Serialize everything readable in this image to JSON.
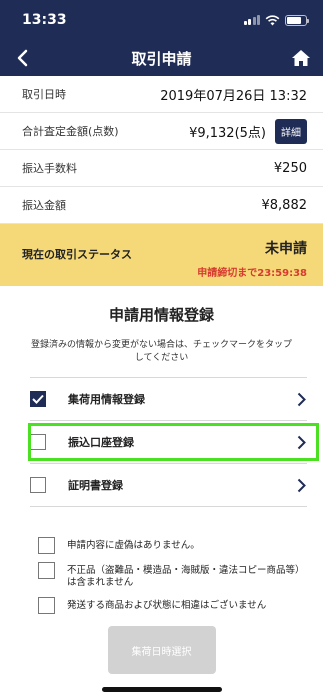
{
  "status_bar": {
    "time": "13:33"
  },
  "nav": {
    "title": "取引申請"
  },
  "info_rows": [
    {
      "label": "取引日時",
      "value": "2019年07月26日 13:32"
    },
    {
      "label": "合計査定金額(点数)",
      "value": "¥9,132(5点)",
      "button": "詳細"
    },
    {
      "label": "振込手数料",
      "value": "¥250"
    },
    {
      "label": "振込金額",
      "value": "¥8,882"
    }
  ],
  "status_panel": {
    "label": "現在の取引ステータス",
    "value": "未申請",
    "deadline": "申請締切まで23:59:38"
  },
  "registration": {
    "title": "申請用情報登録",
    "note": "登録済みの情報から変更がない場合は、チェックマークをタップしてください",
    "items": [
      {
        "label": "集荷用情報登録",
        "checked": true
      },
      {
        "label": "振込口座登録",
        "checked": false
      },
      {
        "label": "証明書登録",
        "checked": false
      }
    ]
  },
  "consents": [
    {
      "label": "申請内容に虚偽はありません。"
    },
    {
      "label": "不正品（盗難品・模造品・海賊版・違法コピー商品等）は含まれません"
    },
    {
      "label": "発送する商品および状態に相違はございません"
    }
  ],
  "submit": {
    "label": "集荷日時選択"
  },
  "colors": {
    "navy": "#1f2c55",
    "status_yellow": "#f5d878",
    "deadline_red": "#d63b2f",
    "highlight_green": "#4be022",
    "disabled_gray": "#d2d2d2"
  },
  "icons": {
    "back": "chevron-left-icon",
    "home": "home-icon",
    "row_arrow": "chevron-right-icon",
    "check": "check-icon"
  }
}
